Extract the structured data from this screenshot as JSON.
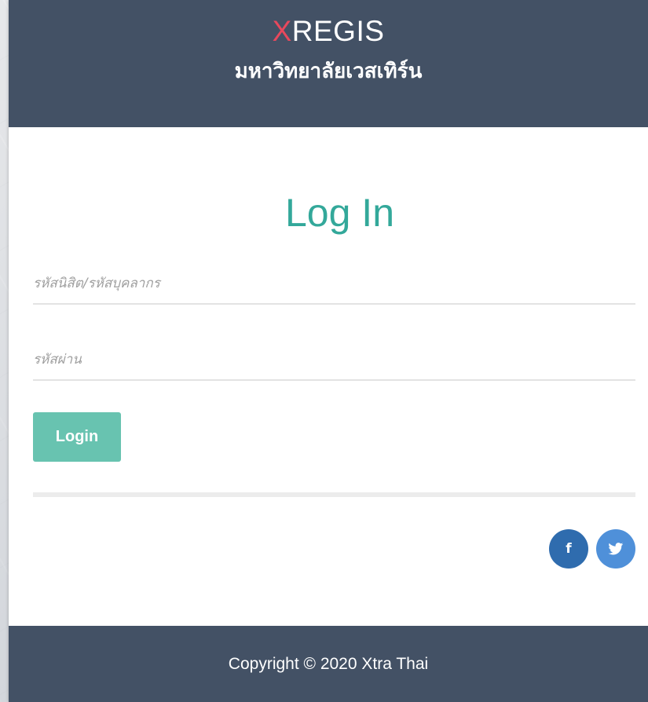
{
  "header": {
    "brand_prefix": "X",
    "brand_name": "REGIS",
    "university": "มหาวิทยาลัยเวสเทิร์น"
  },
  "login": {
    "title": "Log In",
    "username_placeholder": "รหัสนิสิต/รหัสบุคลากร",
    "password_placeholder": "รหัสผ่าน",
    "username_value": "",
    "password_value": "",
    "button_label": "Login"
  },
  "social": {
    "facebook_icon": "f",
    "twitter_icon": "🐦"
  },
  "footer": {
    "copyright": "Copyright © 2020 Xtra Thai"
  },
  "colors": {
    "header_bg": "#435165",
    "brand_accent": "#e8485c",
    "title_color": "#33a89a",
    "button_bg": "#68c3b0",
    "facebook": "#2f6cae",
    "twitter": "#4f90d9"
  }
}
